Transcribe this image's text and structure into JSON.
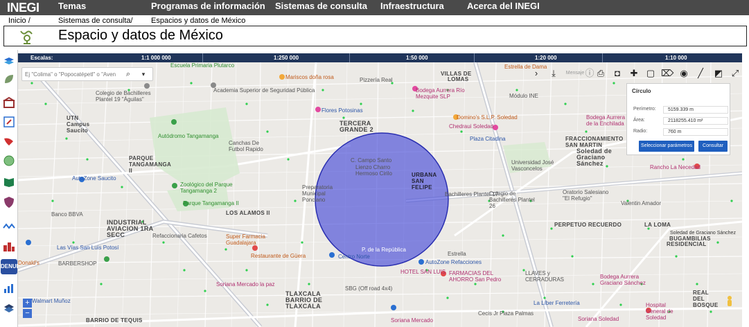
{
  "header": {
    "logo": "INEGI",
    "nav": [
      "Temas",
      "Programas de información",
      "Sistemas de consulta",
      "Infraestructura",
      "Acerca del INEGI"
    ]
  },
  "breadcrumb": [
    "Inicio /",
    "Sistemas de consulta/",
    "Espacios y datos de México"
  ],
  "page_title": "Espacio y datos de México",
  "scalebar": {
    "label": "Escalas:",
    "scales": [
      "1:1 000 000",
      "1:250 000",
      "1:50 000",
      "1:20 000",
      "1:10 000"
    ]
  },
  "search": {
    "placeholder": "Ej \"Colima\" o \"Popocatépetl\" o \"Aven"
  },
  "toolbar": {
    "text_hint": "Mensaje",
    "icons": [
      "chevron-right-icon",
      "download-icon",
      "info-icon",
      "print-icon",
      "camera-icon",
      "pin-icon",
      "square-select-icon",
      "polygon-icon",
      "circle-icon",
      "ruler-icon",
      "eraser-icon",
      "fullscreen-icon"
    ]
  },
  "circle_panel": {
    "title": "Círculo",
    "rows": [
      {
        "label": "Perímetro:",
        "value": "5159.339 m"
      },
      {
        "label": "Área:",
        "value": "2118255.410 m²"
      },
      {
        "label": "Radio:",
        "value": "760 m"
      }
    ],
    "select_button": "Seleccionar parámetros",
    "query_button": "Consultar"
  },
  "left_tools": [
    "layers-icon",
    "leaf-icon",
    "building-icon",
    "compass-icon",
    "hand-icon",
    "globe-icon",
    "book-icon",
    "shield-icon",
    "network-icon",
    "city-icon",
    "denue-icon",
    "chart-icon",
    "stack-icon"
  ],
  "left_tool_denue_label": "DENUE",
  "map": {
    "circle_color": "#3f44d6",
    "labels": {
      "escuela": "Escuela Primaria Plutarco",
      "mariscos": "Mariscos doña rosa",
      "pizzeria": "Pizzería Real",
      "villas": "VILLAS DE",
      "lomas": "LOMAS",
      "estrella": "Estrella de Dama",
      "academia": "Academia Superior de Seguridad Pública",
      "colegio": "Colegio de Bachilleres Plantel 19 \"Águilas\"",
      "utn": "UTN Campus Saucito",
      "modulo": "Módulo INE",
      "bodega_rio": "Bodega Aurrera Río Mezquite SLP",
      "flores": "Flores Potosinas",
      "tercera": "TERCERA GRANDE 2",
      "dominos": "Domino's S.L.P. Soledad",
      "chedraui": "Chedraui Soledad",
      "bodega_enc": "Bodega Aurrera de la Enchilada",
      "autodromo": "Autódromo Tangamanga",
      "canchas": "Canchas De Futbol Rapido",
      "plaza_citadina": "Plaza Citadina",
      "fracc": "FRACCIONAMIENTO SAN MARTIN",
      "soledad": "Soledad de Graciano Sánchez",
      "parque_tm": "PARQUE TANGAMANGA II",
      "autozone1": "AutoZone Saucito",
      "campo": "C. Campo Santo",
      "lienzo": "Lienzo Charro Hermoso Cirilo",
      "urbana": "URBANA SAN FELIPE",
      "univ": "Universidad José Vasconcelos",
      "rancho": "Rancho La Necedad",
      "zoologico": "Zoológico del Parque Tangamanga 2",
      "parque2": "Parque Tangamanga II",
      "prepa": "Preparatoria Municipal Ponciano",
      "bachilleres2": "Bachilleres Plantel 17",
      "colegio_ch": "Colegio de Bachilleres Plantel 26",
      "oratorio": "Oratorio Salesiano \"El Refugio\"",
      "valentin": "Valentin Amador",
      "los_alamos": "LOS ALAMOS II",
      "industrial": "INDUSTRIAL AVIACION 1RA SECC",
      "bodega_bbva": "Banco BBVA",
      "refaccionaria": "Refaccionaria Cafetos",
      "super_farmacia": "Super Farmacia Guadalajara",
      "perpetuo": "PERPETUO RECUERDO",
      "la_loma": "LA LOMA",
      "soledad_gs": "Soledad de Graciano Sánchez",
      "bugambilias": "BUGAMBILIAS",
      "residencial": "RESIDENCIAL",
      "las_vias": "Las Vías San Luis Potosí",
      "barbershop": "BARBERSHOP",
      "restaurante": "Restaurante de Güera",
      "centro_norte": "Centro Norte",
      "republica": "P. de la República",
      "autozone2": "AutoZone Refacciones",
      "estrella2": "Estrella",
      "hotel": "HOTEL SAN LUIS",
      "farmacias": "FARMACIAS DEL AHORRO San Pedro",
      "llaves": "LLAVES y CERRADURAS",
      "bodega_gs": "Bodega Aurrera Graciano Sánchez",
      "walmart": "Walmart Muñoz",
      "soriana": "Soriana Mercado la paz",
      "tlaxcala": "TLAXCALA BARRIO DE TLAXCALA",
      "sbg": "SBG (Off road 4x4)",
      "soriana2": "Soriana Mercado",
      "libre": "La Líber Ferretería",
      "hospital": "Hospital General de Soledad",
      "real_bosque": "REAL DEL BOSQUE",
      "cecis": "Cecis Jr Plaza Palmas",
      "donald": "Donald's",
      "barrio_tequis": "BARRIO DE TEQUIS",
      "aviacion": "AVIACION",
      "soriana_sv": "Soriana Soledad"
    }
  }
}
